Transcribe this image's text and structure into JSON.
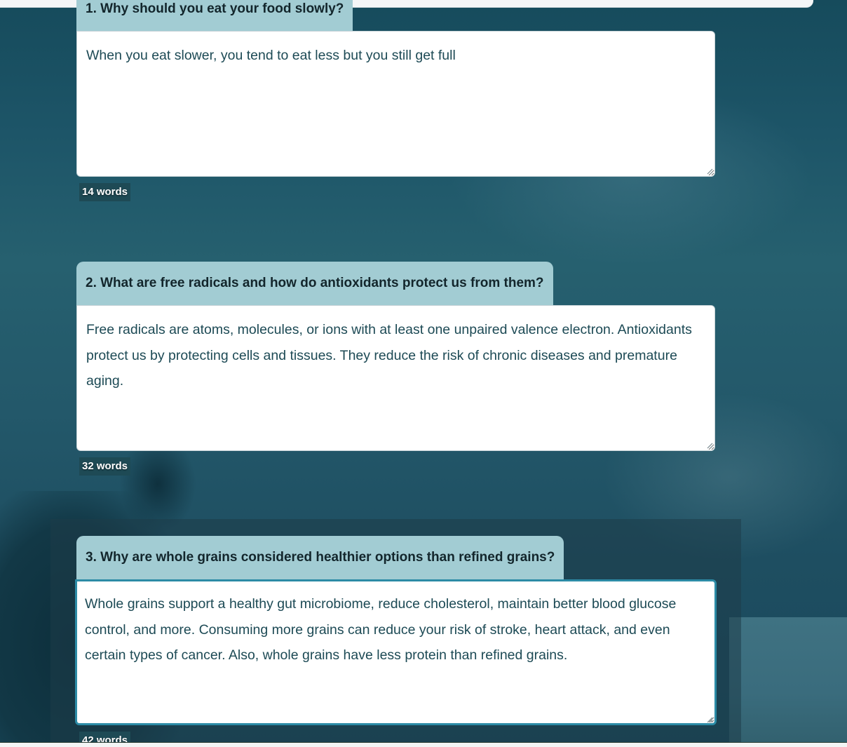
{
  "questions": [
    {
      "label": "1. Why should you eat your food slowly?",
      "answer": "When you eat slower, you tend to eat less but you still get full",
      "word_count": "14 words"
    },
    {
      "label": "2. What are free radicals and how do antioxidants protect us from them?",
      "answer": "Free radicals are atoms, molecules, or ions with at least one unpaired valence electron. Antioxidants protect us by protecting cells and tissues. They reduce the risk of chronic diseases and premature aging.",
      "word_count": "32 words"
    },
    {
      "label": "3. Why are whole grains considered healthier options than refined grains?",
      "answer": "Whole grains support a healthy gut microbiome, reduce cholesterol, maintain better blood glucose control, and more. Consuming more grains can reduce your risk of stroke, heart attack, and even certain types of cancer. Also, whole grains have less protein than refined grains.",
      "word_count": "42 words"
    }
  ],
  "colors": {
    "label_bg": "#a2ccd3",
    "answer_text": "#1d4a55",
    "focus_border": "#2c8ba6",
    "background": "#1d5568"
  }
}
